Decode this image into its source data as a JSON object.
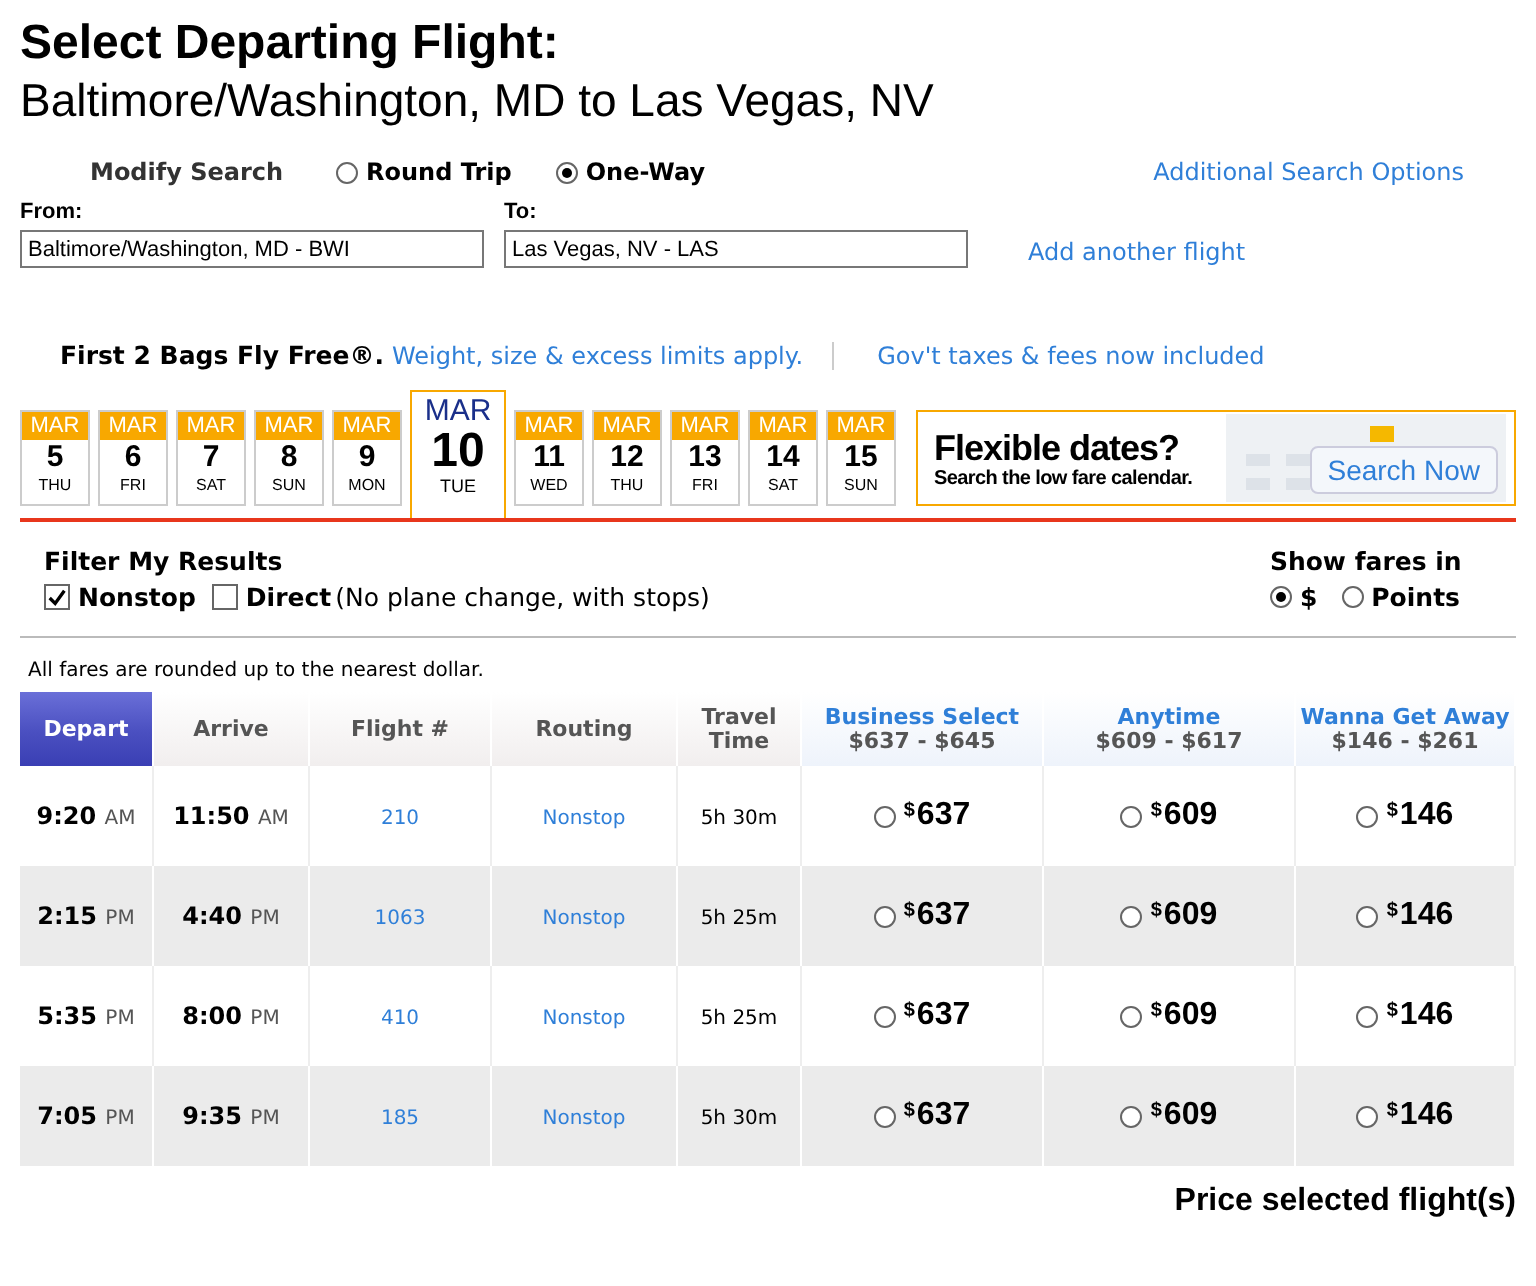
{
  "title": "Select Departing Flight:",
  "subtitle": "Baltimore/Washington, MD to Las Vegas, NV",
  "search": {
    "label": "Modify Search",
    "trip_types": [
      {
        "label": "Round Trip",
        "selected": false
      },
      {
        "label": "One-Way",
        "selected": true
      }
    ],
    "additional_link": "Additional Search Options",
    "from": {
      "label": "From:",
      "value": "Baltimore/Washington, MD - BWI"
    },
    "to": {
      "label": "To:",
      "value": "Las Vegas, NV - LAS"
    },
    "add_flight_link": "Add another flight"
  },
  "notices": {
    "bags": "First 2 Bags Fly Free®.",
    "bags_link": "Weight, size & excess limits apply.",
    "taxes_link": "Gov't taxes & fees now included"
  },
  "dates": [
    {
      "month": "MAR",
      "day": "5",
      "weekday": "THU",
      "selected": false
    },
    {
      "month": "MAR",
      "day": "6",
      "weekday": "FRI",
      "selected": false
    },
    {
      "month": "MAR",
      "day": "7",
      "weekday": "SAT",
      "selected": false
    },
    {
      "month": "MAR",
      "day": "8",
      "weekday": "SUN",
      "selected": false
    },
    {
      "month": "MAR",
      "day": "9",
      "weekday": "MON",
      "selected": false
    },
    {
      "month": "MAR",
      "day": "10",
      "weekday": "TUE",
      "selected": true
    },
    {
      "month": "MAR",
      "day": "11",
      "weekday": "WED",
      "selected": false
    },
    {
      "month": "MAR",
      "day": "12",
      "weekday": "THU",
      "selected": false
    },
    {
      "month": "MAR",
      "day": "13",
      "weekday": "FRI",
      "selected": false
    },
    {
      "month": "MAR",
      "day": "14",
      "weekday": "SAT",
      "selected": false
    },
    {
      "month": "MAR",
      "day": "15",
      "weekday": "SUN",
      "selected": false
    }
  ],
  "promo": {
    "title": "Flexible dates?",
    "subtitle": "Search the low fare calendar.",
    "button": "Search Now"
  },
  "filter": {
    "title": "Filter My Results",
    "options": [
      {
        "label": "Nonstop",
        "checked": true
      },
      {
        "label": "Direct",
        "note": "(No plane change, with stops)",
        "checked": false
      }
    ]
  },
  "fares_in": {
    "title": "Show fares in",
    "options": [
      {
        "label": "$",
        "selected": true
      },
      {
        "label": "Points",
        "selected": false
      }
    ]
  },
  "rounding_note": "All fares are rounded up to the nearest dollar.",
  "table": {
    "columns": [
      {
        "kind": "plain",
        "label": "Depart",
        "active": true
      },
      {
        "kind": "plain",
        "label": "Arrive",
        "active": false
      },
      {
        "kind": "plain",
        "label": "Flight #",
        "active": false
      },
      {
        "kind": "plain",
        "label": "Routing",
        "active": false
      },
      {
        "kind": "plain",
        "label": "Travel Time",
        "active": false
      },
      {
        "kind": "fare",
        "label": "Business Select",
        "range": "$637 - $645",
        "active": false
      },
      {
        "kind": "fare",
        "label": "Anytime",
        "range": "$609 - $617",
        "active": false
      },
      {
        "kind": "fare",
        "label": "Wanna Get Away",
        "range": "$146 - $261",
        "active": false
      }
    ],
    "rows": [
      {
        "depart": {
          "time": "9:20",
          "ampm": "AM"
        },
        "arrive": {
          "time": "11:50",
          "ampm": "AM"
        },
        "flight": "210",
        "routing": "Nonstop",
        "travel_time": "5h 30m",
        "fares": [
          {
            "currency": "$",
            "amount": "637",
            "selected": false
          },
          {
            "currency": "$",
            "amount": "609",
            "selected": false
          },
          {
            "currency": "$",
            "amount": "146",
            "selected": false
          }
        ]
      },
      {
        "depart": {
          "time": "2:15",
          "ampm": "PM"
        },
        "arrive": {
          "time": "4:40",
          "ampm": "PM"
        },
        "flight": "1063",
        "routing": "Nonstop",
        "travel_time": "5h 25m",
        "fares": [
          {
            "currency": "$",
            "amount": "637",
            "selected": false
          },
          {
            "currency": "$",
            "amount": "609",
            "selected": false
          },
          {
            "currency": "$",
            "amount": "146",
            "selected": false
          }
        ]
      },
      {
        "depart": {
          "time": "5:35",
          "ampm": "PM"
        },
        "arrive": {
          "time": "8:00",
          "ampm": "PM"
        },
        "flight": "410",
        "routing": "Nonstop",
        "travel_time": "5h 25m",
        "fares": [
          {
            "currency": "$",
            "amount": "637",
            "selected": false
          },
          {
            "currency": "$",
            "amount": "609",
            "selected": false
          },
          {
            "currency": "$",
            "amount": "146",
            "selected": false
          }
        ]
      },
      {
        "depart": {
          "time": "7:05",
          "ampm": "PM"
        },
        "arrive": {
          "time": "9:35",
          "ampm": "PM"
        },
        "flight": "185",
        "routing": "Nonstop",
        "travel_time": "5h 30m",
        "fares": [
          {
            "currency": "$",
            "amount": "637",
            "selected": false
          },
          {
            "currency": "$",
            "amount": "609",
            "selected": false
          },
          {
            "currency": "$",
            "amount": "146",
            "selected": false
          }
        ]
      }
    ]
  },
  "price_button": "Price selected flight(s)"
}
